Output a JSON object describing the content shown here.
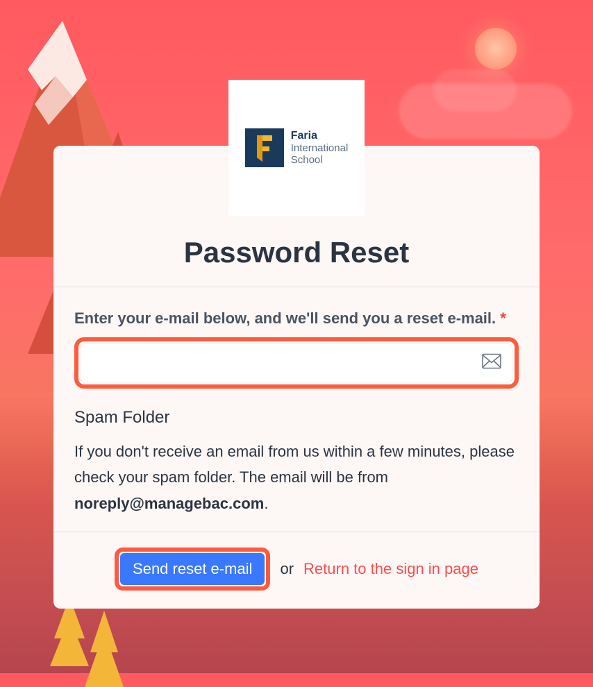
{
  "logo": {
    "line1": "Faria",
    "line2": "International",
    "line3": "School"
  },
  "panel": {
    "title": "Password Reset",
    "field_label": "Enter your e-mail below, and we'll send you a reset e-mail.",
    "required_marker": "*",
    "email_value": "",
    "spam_heading": "Spam Folder",
    "spam_text_prefix": "If you don't receive an email from us within a few minutes, please check your spam folder. The email will be from ",
    "spam_email": "noreply@managebac.com",
    "spam_text_suffix": "."
  },
  "footer": {
    "send_label": "Send reset e-mail",
    "or_label": "or",
    "return_label": "Return to the sign in page"
  }
}
